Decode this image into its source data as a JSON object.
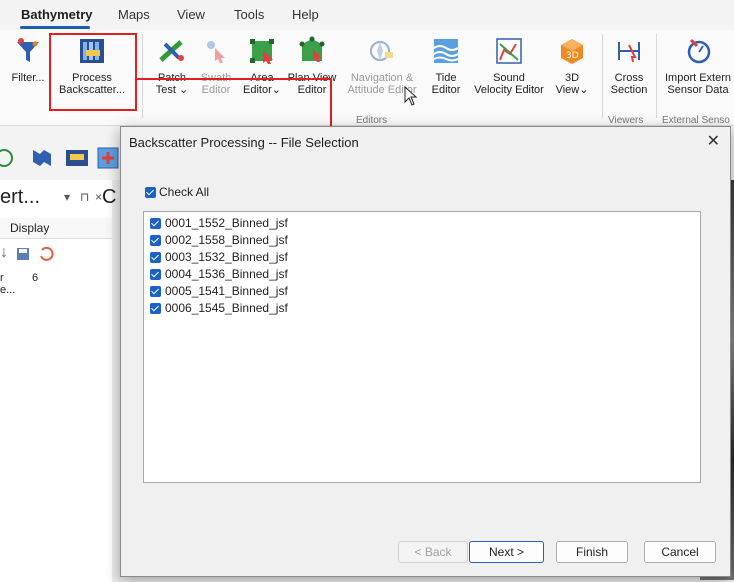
{
  "tabs": [
    {
      "label": "Bathymetry",
      "active": true
    },
    {
      "label": "Maps"
    },
    {
      "label": "View"
    },
    {
      "label": "Tools"
    },
    {
      "label": "Help"
    }
  ],
  "ribbon": {
    "filter_label": "Filter...",
    "process_line1": "Process",
    "process_line2": "Backscatter...",
    "patch_line1": "Patch",
    "patch_line2": "Test",
    "swath_line1": "Swath",
    "swath_line2": "Editor",
    "area_line1": "Area",
    "area_line2": "Editor",
    "planview_line1": "Plan View",
    "planview_line2": "Editor",
    "nav_line1": "Navigation &",
    "nav_line2": "Attitude Editor",
    "tide_line1": "Tide",
    "tide_line2": "Editor",
    "sound_line1": "Sound",
    "sound_line2": "Velocity Editor",
    "view3d_line1": "3D",
    "view3d_line2": "View",
    "cross_line1": "Cross",
    "cross_line2": "Section",
    "import_line1": "Import Extern",
    "import_line2": "Sensor Data",
    "group_editors": "Editors",
    "group_viewers": "Viewers",
    "group_external": "External Senso"
  },
  "left_pane": {
    "title": "ert...",
    "display_tab": "Display",
    "row_label": "r e...",
    "row_value": "6",
    "c_letter": "C"
  },
  "dialog": {
    "title": "Backscatter Processing -- File Selection",
    "check_all": "Check All",
    "files": [
      "0001_1552_Binned_jsf",
      "0002_1558_Binned_jsf",
      "0003_1532_Binned_jsf",
      "0004_1536_Binned_jsf",
      "0005_1541_Binned_jsf",
      "0006_1545_Binned_jsf"
    ],
    "back_label": "< Back",
    "next_label": "Next >",
    "finish_label": "Finish",
    "cancel_label": "Cancel"
  },
  "colors": {
    "accent": "#1a62c5",
    "highlight": "#e02020"
  }
}
